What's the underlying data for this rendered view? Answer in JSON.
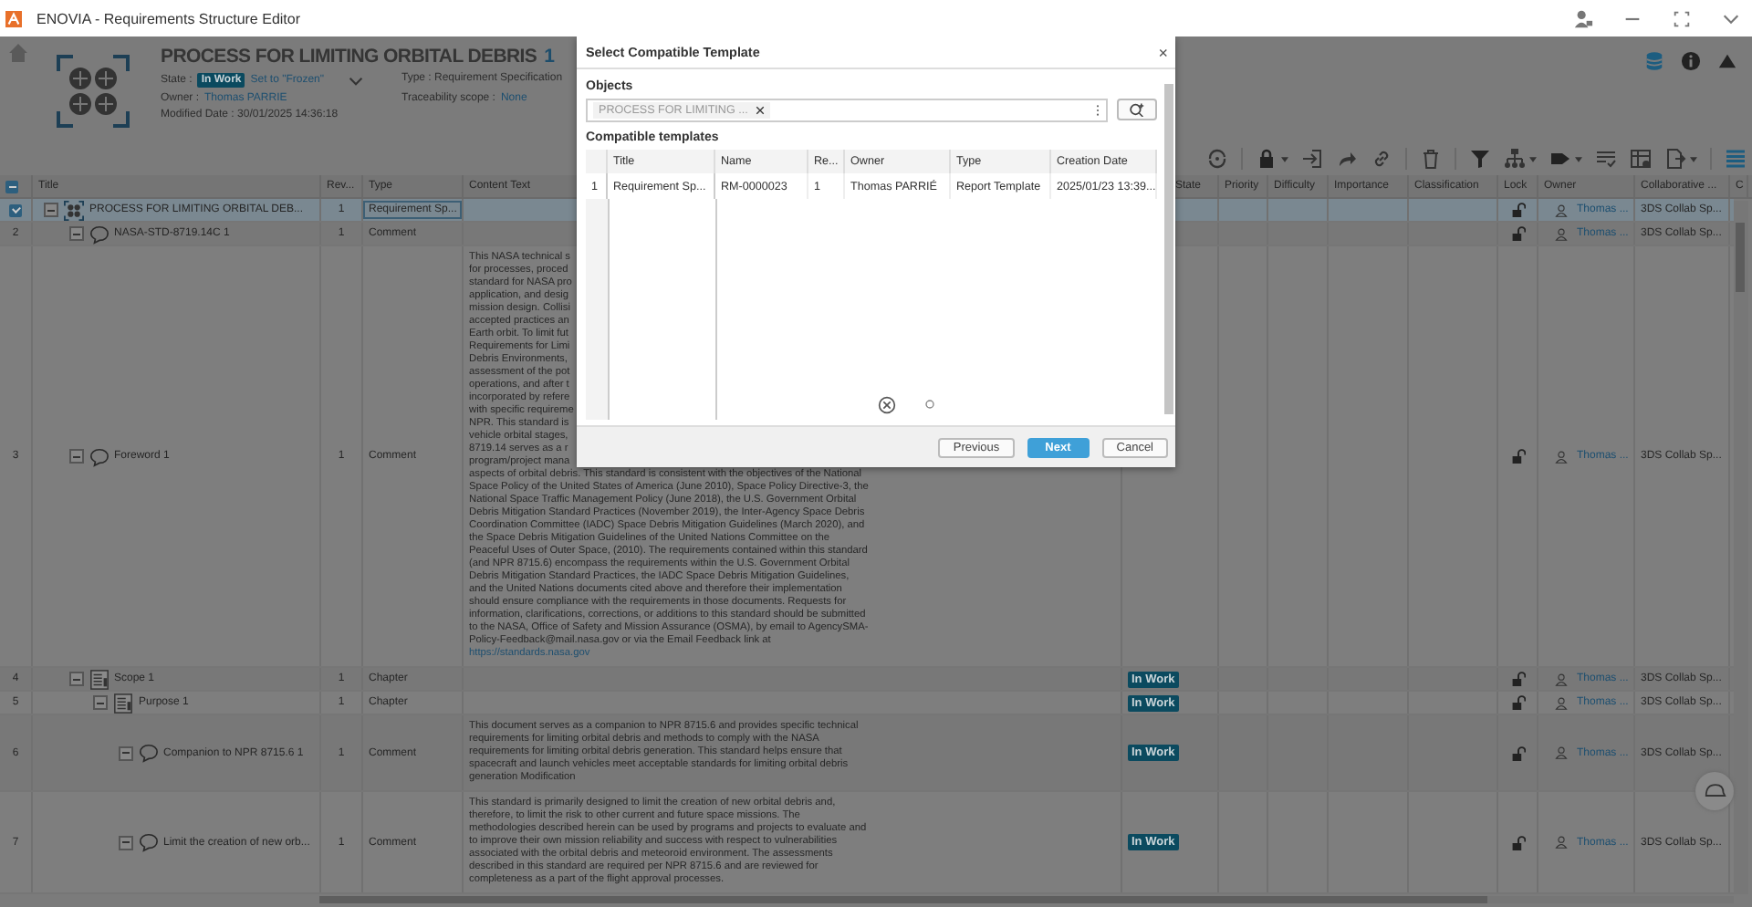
{
  "app_bar": {
    "title": "ENOVIA - Requirements Structure Editor"
  },
  "header": {
    "title": "PROCESS FOR LIMITING ORBITAL DEBRIS",
    "revision": "1",
    "state_label": "State :",
    "state": "In Work",
    "promote_link": "Set to \"Frozen\"",
    "owner_label": "Owner :",
    "owner": "Thomas PARRIE",
    "modified": "Modified Date : 30/01/2025 14:36:18",
    "type": "Type : Requirement Specification",
    "scope_label": "Traceability scope :",
    "scope": "None"
  },
  "table": {
    "select_all_mixed": true,
    "columns": [
      "Title",
      "Rev...",
      "Type",
      "Content Text",
      "State",
      "Priority",
      "Difficulty",
      "Importance",
      "Classification",
      "Lock",
      "Owner",
      "Collaborative ...",
      "C"
    ],
    "rows": [
      {
        "selected": true,
        "expanded": true,
        "kind": "specification",
        "title": "PROCESS FOR LIMITING ORBITAL DEB...",
        "rev": "1",
        "type": "Requirement Sp...",
        "locked": false,
        "owner": "Thomas ...",
        "collab": "3DS Collab Sp...",
        "children": [
          {
            "number": "2",
            "selected": false,
            "expanded": true,
            "kind": "comment",
            "title": "NASA-STD-8719.14C  1",
            "rev": "1",
            "type": "Comment",
            "locked": false,
            "owner": "Thomas ...",
            "collab": "3DS Collab Sp..."
          },
          {
            "number": "3",
            "selected": false,
            "expanded": true,
            "kind": "comment",
            "title": "Foreword  1",
            "rev": "1",
            "type": "Comment",
            "locked": false,
            "owner": "Thomas ...",
            "collab": "3DS Collab Sp...",
            "content": [
              "This NASA technical s",
              "for processes, proced",
              "standard for NASA pro",
              "application, and desig",
              "mission design. Collisi",
              "accepted practices an",
              "Earth orbit. To limit fut",
              "Requirements for Limi",
              "Debris Environments,",
              "assessment of the pot",
              "operations, and after t",
              "incorporated by refere",
              "with specific requireme",
              "NPR. This standard is",
              "vehicle orbital stages,",
              "8719.14 serves as a r",
              "program/project mana",
              "aspects of orbital debris. This standard is consistent with the objectives of the National",
              "Space Policy of the United States of America (June 2010), Space Policy Directive-3, the",
              "National Space Traffic Management Policy (June 2018), the U.S. Government Orbital",
              "Debris Mitigation Standard Practices (November 2019), the Inter-Agency Space Debris",
              "Coordination Committee (IADC) Space Debris Mitigation Guidelines (March 2020), and",
              "the Space Debris Mitigation Guidelines of the United Nations Committee on the",
              "Peaceful Uses of Outer Space, (2010). The requirements contained within this standard",
              "(and NPR 8715.6) encompass the requirements within the U.S. Government Orbital",
              "Debris Mitigation Standard Practices, the IADC Space Debris Mitigation Guidelines,",
              "and the United Nations documents cited above and therefore their implementation",
              "should ensure compliance with the requirements in those documents. Requests for",
              "information, clarifications, corrections, or additions to this standard should be submitted",
              "to the NASA, Office of Safety and Mission Assurance (OSMA), by email to AgencySMA-",
              "Policy-Feedback@mail.nasa.gov or via the Email Feedback link at"
            ],
            "link": "https://standards.nasa.gov"
          },
          {
            "number": "4",
            "selected": false,
            "expanded": true,
            "kind": "chapter",
            "title": "Scope  1",
            "rev": "1",
            "type": "Chapter",
            "state": "In Work",
            "locked": false,
            "owner": "Thomas ...",
            "collab": "3DS Collab Sp...",
            "children": [
              {
                "number": "5",
                "selected": false,
                "expanded": true,
                "kind": "chapter",
                "title": "Purpose  1",
                "rev": "1",
                "type": "Chapter",
                "state": "In Work",
                "locked": false,
                "owner": "Thomas ...",
                "collab": "3DS Collab Sp...",
                "children": [
                  {
                    "number": "6",
                    "selected": false,
                    "expanded": true,
                    "kind": "comment",
                    "title": "Companion to NPR 8715.6  1",
                    "rev": "1",
                    "type": "Comment",
                    "state": "In Work",
                    "locked": false,
                    "owner": "Thomas ...",
                    "collab": "3DS Collab Sp...",
                    "content": [
                      "This document serves as a companion to NPR 8715.6 and provides specific technical",
                      "requirements for limiting orbital debris and methods to comply with the NASA",
                      "requirements for limiting orbital debris generation. This standard helps ensure that",
                      "spacecraft and launch vehicles meet acceptable standards for limiting orbital debris",
                      "generation Modification"
                    ]
                  },
                  {
                    "number": "7",
                    "selected": false,
                    "expanded": true,
                    "kind": "comment",
                    "title": "Limit the creation of new orb...",
                    "rev": "1",
                    "type": "Comment",
                    "state": "In Work",
                    "locked": false,
                    "owner": "Thomas ...",
                    "collab": "3DS Collab Sp...",
                    "content": [
                      "This standard is primarily designed to limit the creation of new orbital debris and,",
                      "therefore, to limit the risk to other current and future space missions. The",
                      "methodologies described herein can be used by programs and projects to evaluate and",
                      "to improve their own mission reliability and success with respect to vulnerabilities",
                      "associated with the orbital debris and meteoroid environment. The assessments",
                      "described in this standard are required per NPR 8715.6 and are reviewed for",
                      "completeness as a part of the flight approval processes."
                    ]
                  }
                ]
              }
            ]
          }
        ]
      }
    ]
  },
  "dialog": {
    "title": "Select Compatible Template",
    "close": "×",
    "objects_label": "Objects",
    "object_chip": "PROCESS FOR LIMITING ...",
    "templates_label": "Compatible templates",
    "columns": [
      "Title",
      "Name",
      "Re...",
      "Owner",
      "Type",
      "Creation Date"
    ],
    "rows": [
      {
        "number": "1",
        "title": "Requirement Sp...",
        "name": "RM-0000023",
        "rev": "1",
        "owner": "Thomas PARRIÉ",
        "type": "Report Template",
        "created": "2025/01/23 13:39..."
      }
    ],
    "buttons": [
      {
        "label": "Previous",
        "kind": "secondary"
      },
      {
        "label": "Next",
        "kind": "primary"
      },
      {
        "label": "Cancel",
        "kind": "secondary"
      }
    ]
  }
}
